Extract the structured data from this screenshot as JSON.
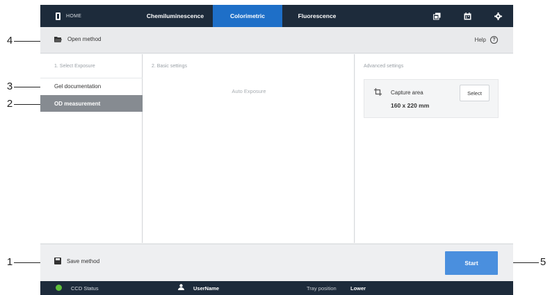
{
  "callouts": [
    "4",
    "3",
    "2",
    "1",
    "5"
  ],
  "topbar": {
    "home_label": "HOME",
    "tabs": [
      {
        "label": "Chemiluminescence",
        "active": false
      },
      {
        "label": "Colorimetric",
        "active": true
      },
      {
        "label": "Fluorescence",
        "active": false
      }
    ],
    "icons": [
      "images-icon",
      "calendar-icon",
      "gear-icon"
    ]
  },
  "subbar": {
    "open_method_label": "Open method",
    "help_label": "Help"
  },
  "exposure": {
    "title": "1. Select Exposure",
    "options": [
      {
        "label": "Gel documentation",
        "selected": false
      },
      {
        "label": "OD measurement",
        "selected": true
      }
    ]
  },
  "basic": {
    "title": "2. Basic settings",
    "auto_exposure": "Auto Exposure"
  },
  "advanced": {
    "title": "Advanced settings",
    "capture_label": "Capture area",
    "capture_value": "160 x 220 mm",
    "select_label": "Select"
  },
  "footer": {
    "save_method_label": "Save method",
    "start_label": "Start"
  },
  "status": {
    "ccd_label": "CCD Status",
    "user_name": "UserName",
    "tray_label": "Tray position",
    "tray_value": "Lower"
  },
  "colors": {
    "topbar": "#1d2b3b",
    "active_tab": "#1e6fc8",
    "start_button": "#4a8fde",
    "selected_option": "#868b91",
    "ccd_ok": "#5fbf3a"
  }
}
